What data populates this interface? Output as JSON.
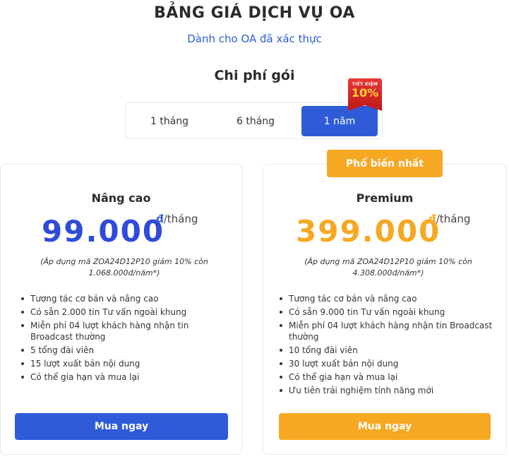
{
  "header": {
    "title": "BẢNG GIÁ DỊCH VỤ OA",
    "subtitle": "Dành cho OA đã xác thực",
    "section": "Chi phí gói"
  },
  "tabs": [
    {
      "label": "1 tháng",
      "active": false
    },
    {
      "label": "6 tháng",
      "active": false
    },
    {
      "label": "1 năm",
      "active": true
    }
  ],
  "ribbon": {
    "small": "TIẾT KIỆM",
    "big": "10%"
  },
  "popular_badge": "Phổ biến nhất",
  "colors": {
    "accent_blue": "#2f5bd8",
    "accent_orange": "#f6a823",
    "ribbon_red": "#d42626"
  },
  "plans": [
    {
      "name": "Nâng cao",
      "price": "99.000",
      "currency_symbol": "đ",
      "period": "/tháng",
      "note": "(Áp dụng mã ZOA24D12P10 giảm 10% còn 1.068.000đ/năm*)",
      "features": [
        "Tương tác cơ bản và nâng cao",
        "Có sẵn 2.000 tin Tư vấn ngoài khung",
        "Miễn phí 04 lượt khách hàng nhận tin Broadcast thường",
        "5 tổng đài viên",
        "15 lượt xuất bản nội dung",
        "Có thể gia hạn và mua lại"
      ],
      "button": "Mua ngay"
    },
    {
      "name": "Premium",
      "price": "399.000",
      "currency_symbol": "đ",
      "period": "/tháng",
      "note": "(Áp dụng mã ZOA24D12P10 giảm 10% còn 4.308.000đ/năm*)",
      "features": [
        "Tương tác cơ bản và nâng cao",
        "Có sẵn 9.000 tin Tư vấn ngoài khung",
        "Miễn phí 04 lượt khách hàng nhận tin Broadcast thường",
        "10 tổng đài viên",
        "30 lượt xuất bản nội dung",
        "Có thể gia hạn và mua lại",
        "Ưu tiên trải nghiệm tính năng mới"
      ],
      "button": "Mua ngay"
    }
  ]
}
